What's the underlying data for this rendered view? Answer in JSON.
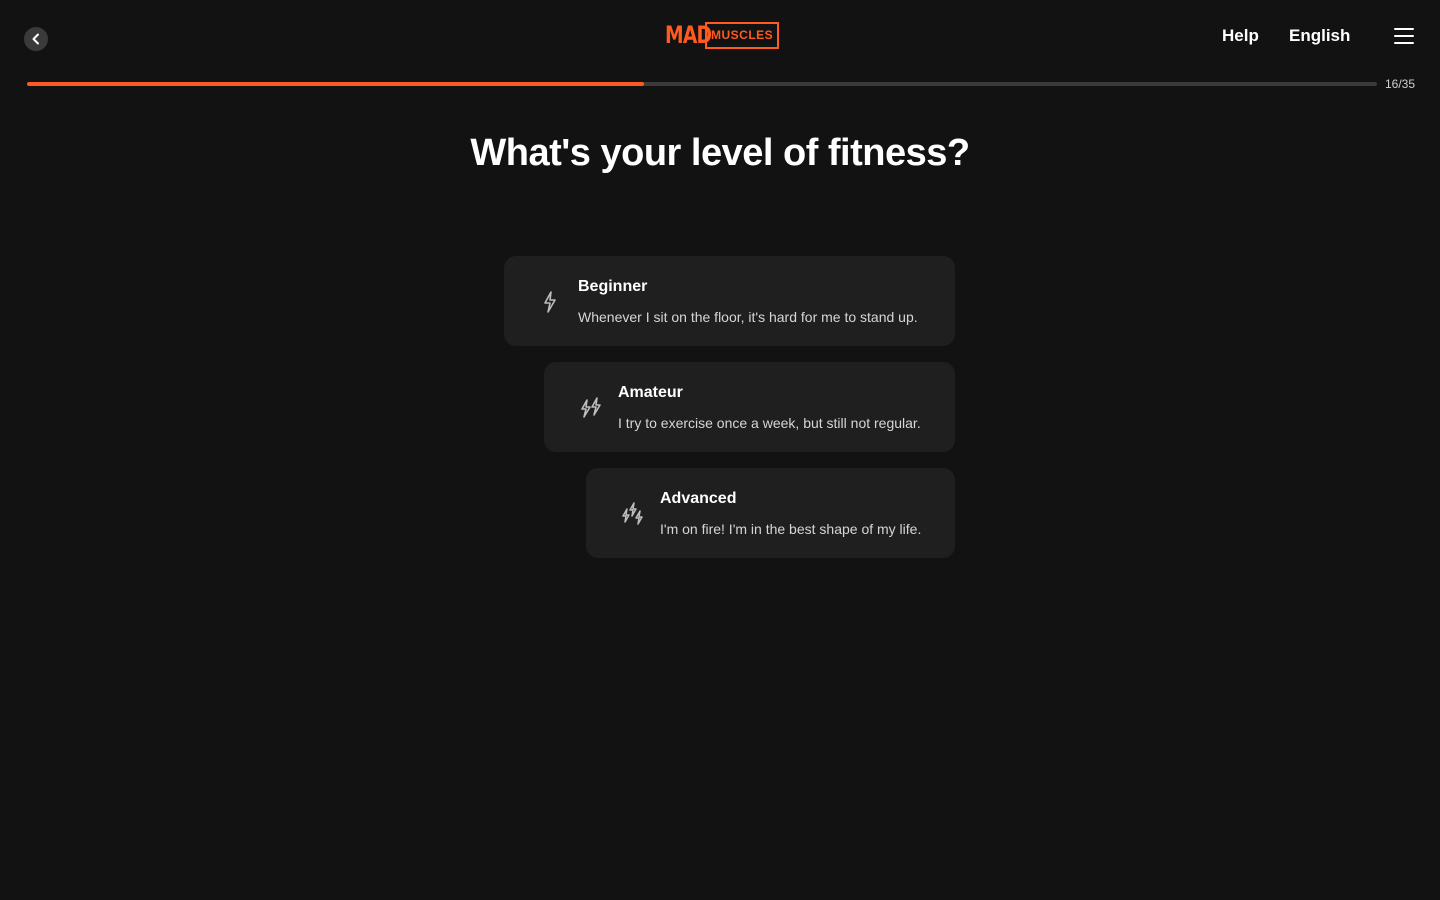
{
  "header": {
    "logo_mad": "MAD",
    "logo_muscles": "MUSCLES",
    "help_label": "Help",
    "language_label": "English"
  },
  "progress": {
    "label": "16/35",
    "fraction": 0.457,
    "color": "#ff5a1f"
  },
  "question": {
    "title": "What's your level of fitness?"
  },
  "options": [
    {
      "title": "Beginner",
      "description": "Whenever I sit on the floor, it's hard for me to stand up.",
      "icon": "lightning-single-icon"
    },
    {
      "title": "Amateur",
      "description": "I try to exercise once a week, but still not regular.",
      "icon": "lightning-double-icon"
    },
    {
      "title": "Advanced",
      "description": "I'm on fire! I'm in the best shape of my life.",
      "icon": "lightning-triple-icon"
    }
  ]
}
